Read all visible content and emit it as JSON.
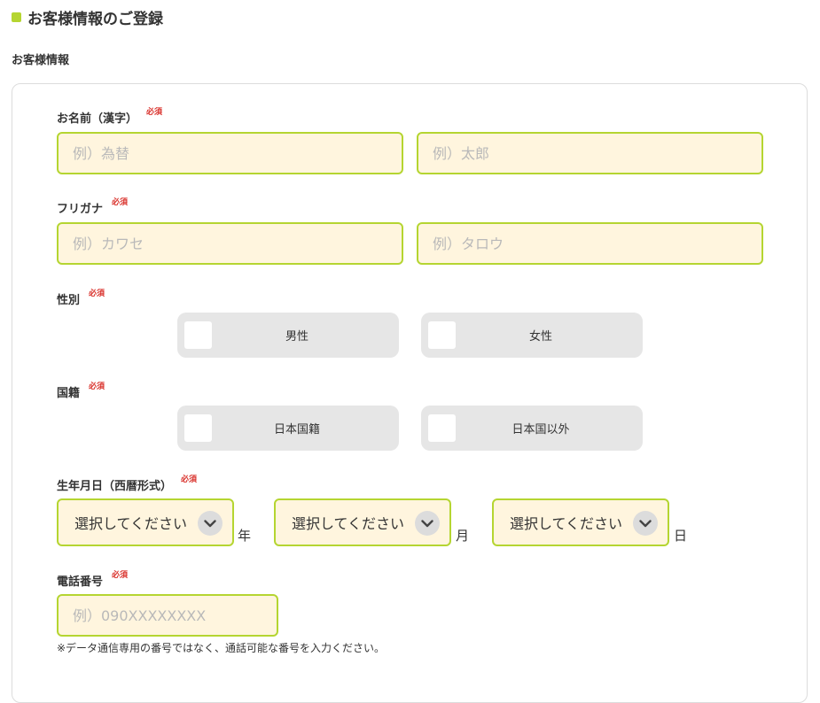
{
  "page": {
    "title": "お客様情報のご登録",
    "section": "お客様情報"
  },
  "required_badge": "必須",
  "fields": {
    "name": {
      "label": "お名前（漢字）",
      "last_placeholder": "例）為替",
      "first_placeholder": "例）太郎",
      "last_value": "",
      "first_value": ""
    },
    "furigana": {
      "label": "フリガナ",
      "last_placeholder": "例）カワセ",
      "first_placeholder": "例）タロウ",
      "last_value": "",
      "first_value": ""
    },
    "gender": {
      "label": "性別",
      "options": [
        "男性",
        "女性"
      ],
      "selected": null
    },
    "nationality": {
      "label": "国籍",
      "options": [
        "日本国籍",
        "日本国以外"
      ],
      "selected": null
    },
    "birthdate": {
      "label": "生年月日（西暦形式）",
      "year": {
        "value": "選択してください",
        "unit": "年"
      },
      "month": {
        "value": "選択してください",
        "unit": "月"
      },
      "day": {
        "value": "選択してください",
        "unit": "日"
      }
    },
    "phone": {
      "label": "電話番号",
      "placeholder": "例）090XXXXXXXX",
      "value": "",
      "note": "※データ通信専用の番号ではなく、通話可能な番号を入力ください。"
    }
  },
  "colors": {
    "accent": "#b5d531",
    "input_bg": "#fff5de",
    "required": "#d9302a",
    "choice_bg": "#e6e6e6"
  },
  "icons": {
    "select_chevron": "chevron-down-icon"
  }
}
